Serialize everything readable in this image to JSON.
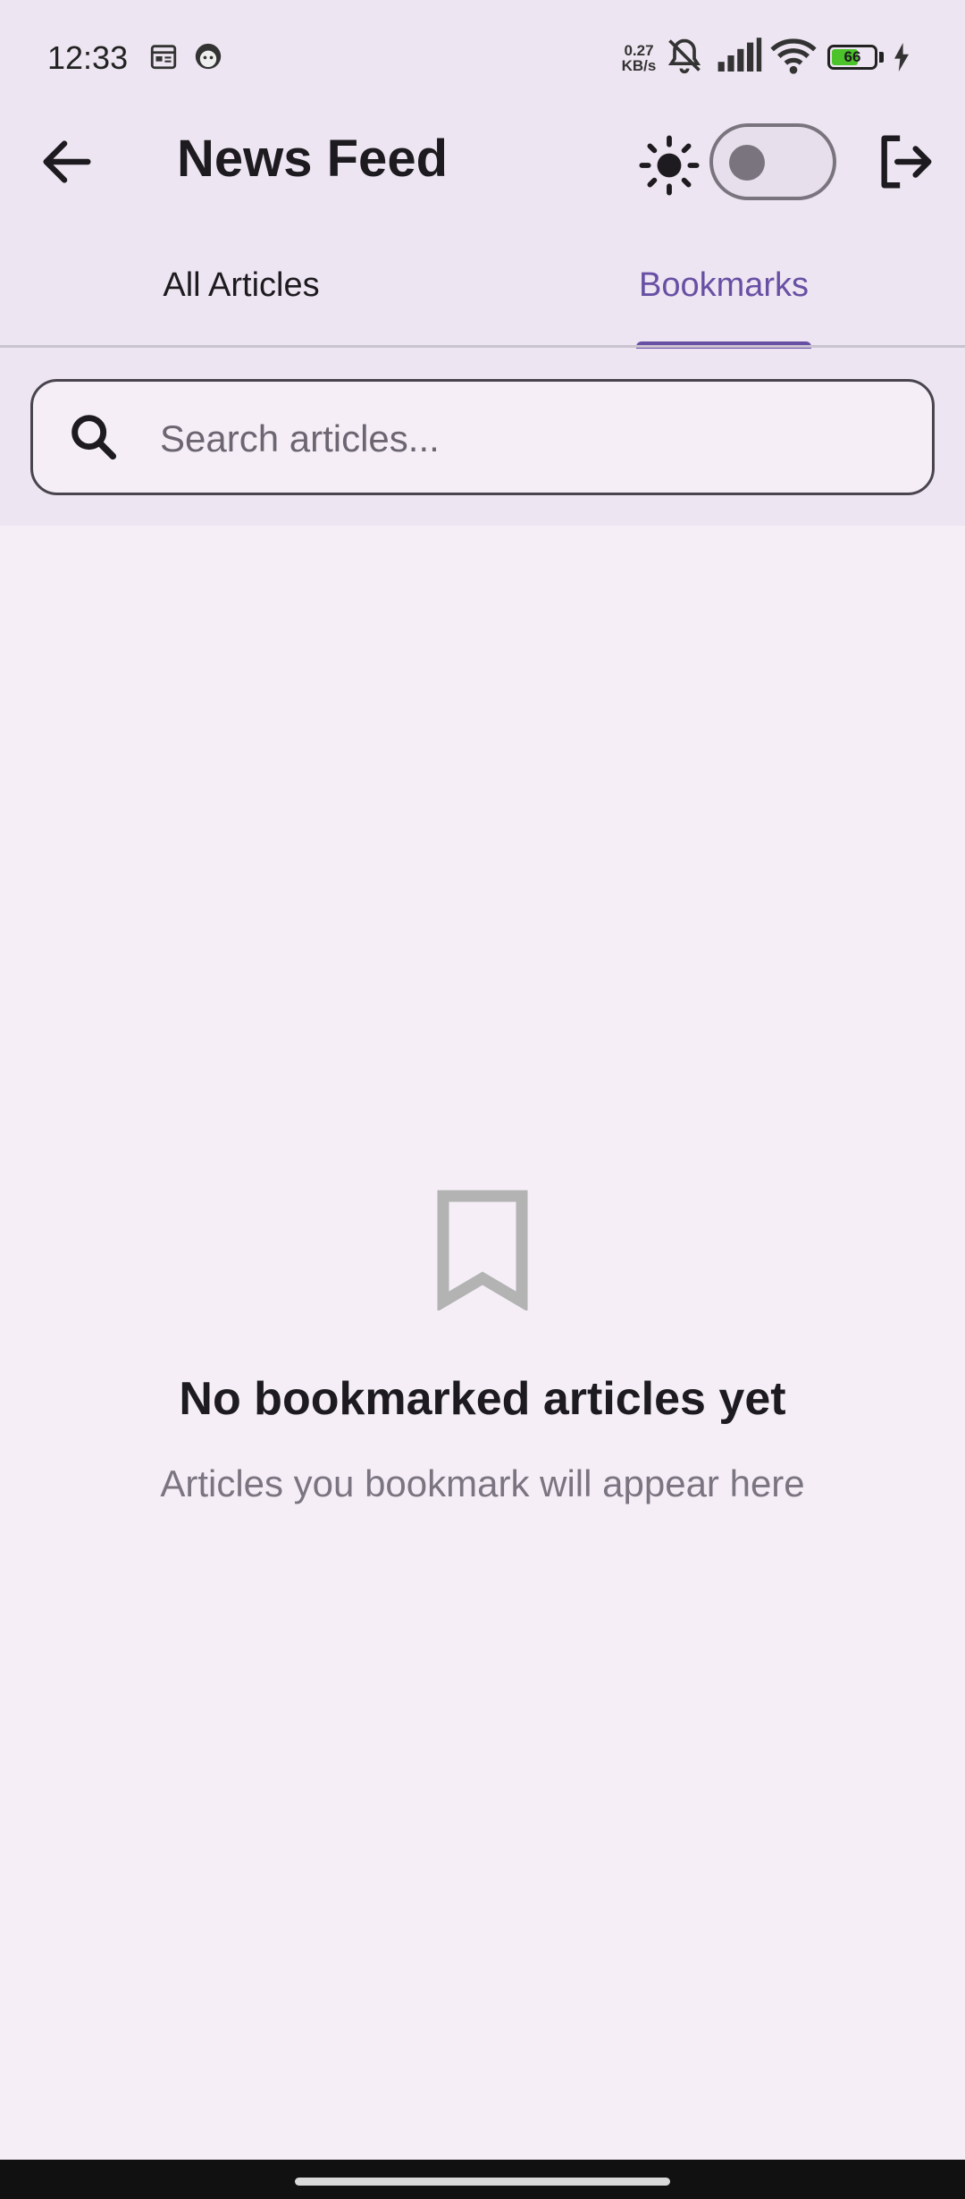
{
  "status_bar": {
    "time": "12:33",
    "net_speed_value": "0.27",
    "net_speed_unit": "KB/s",
    "battery_level": "66",
    "icons": [
      "calendar-icon",
      "face-icon",
      "bell-muted-icon",
      "signal-icon",
      "wifi-icon",
      "battery-icon",
      "charging-icon"
    ]
  },
  "app_bar": {
    "title": "News Feed",
    "back_icon": "arrow-left-icon",
    "theme_icon": "sun-icon",
    "theme_toggle_on": false,
    "logout_icon": "logout-icon"
  },
  "tabs": [
    {
      "label": "All Articles",
      "selected": false
    },
    {
      "label": "Bookmarks",
      "selected": true
    }
  ],
  "search": {
    "placeholder": "Search articles...",
    "value": ""
  },
  "empty_state": {
    "icon": "bookmark-icon",
    "title": "No bookmarked articles yet",
    "subtitle": "Articles you bookmark will appear here"
  },
  "colors": {
    "accent": "#6750a4",
    "background": "#f5eef7",
    "header": "#ede5f1",
    "battery": "#4cc32a"
  }
}
